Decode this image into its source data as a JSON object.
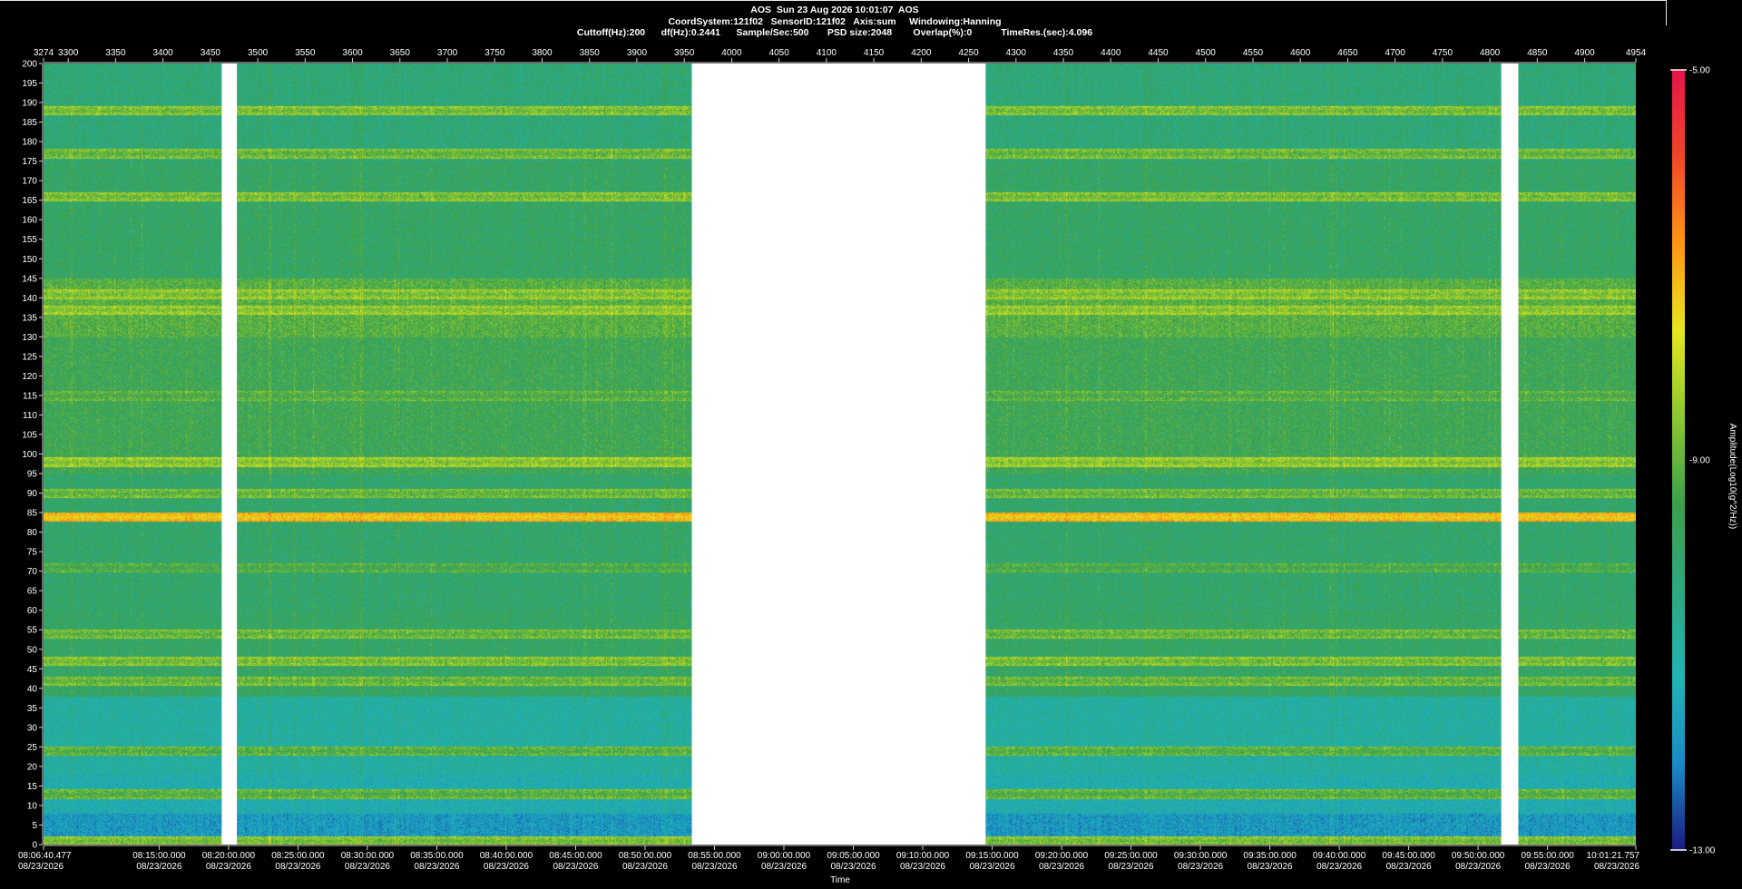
{
  "header": {
    "line1": "AOS  Sun 23 Aug 2026 10:01:07  AOS",
    "line2": "CoordSystem:121f02   SensorID:121f02   Axis:sum     Windowing:Hanning",
    "line3": "Cuttoff(Hz):200      df(Hz):0.2441      Sample/Sec:500       PSD size:2048        Overlap(%):0           TimeRes.(sec):4.096"
  },
  "chart_data": {
    "type": "heatmap",
    "title": "AOS  Sun 23 Aug 2026 10:01:07  AOS",
    "xlabel": "Time",
    "top_axis": {
      "range": [
        3274,
        4954
      ],
      "ticks": [
        "3274",
        "3300",
        "3350",
        "3400",
        "3450",
        "3500",
        "3550",
        "3600",
        "3650",
        "3700",
        "3750",
        "3800",
        "3850",
        "3900",
        "3950",
        "4000",
        "4050",
        "4100",
        "4150",
        "4200",
        "4250",
        "4300",
        "4350",
        "4400",
        "4450",
        "4500",
        "4550",
        "4600",
        "4650",
        "4700",
        "4750",
        "4800",
        "4850",
        "4900",
        "4954"
      ]
    },
    "y_axis": {
      "range": [
        0,
        200
      ],
      "ticks": [
        "0",
        "5",
        "10",
        "15",
        "20",
        "25",
        "30",
        "35",
        "40",
        "45",
        "50",
        "55",
        "60",
        "65",
        "70",
        "75",
        "80",
        "85",
        "90",
        "95",
        "100",
        "105",
        "110",
        "115",
        "120",
        "125",
        "130",
        "135",
        "140",
        "145",
        "150",
        "155",
        "160",
        "165",
        "170",
        "175",
        "180",
        "185",
        "190",
        "195",
        "200"
      ]
    },
    "time_ticks": [
      {
        "time": "08:06:40.477",
        "date": "08/23/2026"
      },
      {
        "time": "08:15:00.000",
        "date": "08/23/2026"
      },
      {
        "time": "08:20:00.000",
        "date": "08/23/2026"
      },
      {
        "time": "08:25:00.000",
        "date": "08/23/2026"
      },
      {
        "time": "08:30:00.000",
        "date": "08/23/2026"
      },
      {
        "time": "08:35:00.000",
        "date": "08/23/2026"
      },
      {
        "time": "08:40:00.000",
        "date": "08/23/2026"
      },
      {
        "time": "08:45:00.000",
        "date": "08/23/2026"
      },
      {
        "time": "08:50:00.000",
        "date": "08/23/2026"
      },
      {
        "time": "08:55:00.000",
        "date": "08/23/2026"
      },
      {
        "time": "09:00:00.000",
        "date": "08/23/2026"
      },
      {
        "time": "09:05:00.000",
        "date": "08/23/2026"
      },
      {
        "time": "09:10:00.000",
        "date": "08/23/2026"
      },
      {
        "time": "09:15:00.000",
        "date": "08/23/2026"
      },
      {
        "time": "09:20:00.000",
        "date": "08/23/2026"
      },
      {
        "time": "09:25:00.000",
        "date": "08/23/2026"
      },
      {
        "time": "09:30:00.000",
        "date": "08/23/2026"
      },
      {
        "time": "09:35:00.000",
        "date": "08/23/2026"
      },
      {
        "time": "09:40:00.000",
        "date": "08/23/2026"
      },
      {
        "time": "09:45:00.000",
        "date": "08/23/2026"
      },
      {
        "time": "09:50:00.000",
        "date": "08/23/2026"
      },
      {
        "time": "09:55:00.000",
        "date": "08/23/2026"
      },
      {
        "time": "10:01:21.757",
        "date": "08/23/2026"
      }
    ],
    "data_gaps_x": [
      [
        3462,
        3478
      ],
      [
        3958,
        4268
      ],
      [
        4812,
        4830
      ]
    ],
    "frequency_bands_hz": [
      {
        "hz": 1,
        "level": -9.0
      },
      {
        "hz": 4,
        "level": -12.3
      },
      {
        "hz": 13,
        "level": -9.4
      },
      {
        "hz": 16,
        "level": -11.6
      },
      {
        "hz": 24,
        "level": -9.4
      },
      {
        "hz": 42,
        "level": -9.2
      },
      {
        "hz": 47,
        "level": -9.0
      },
      {
        "hz": 54,
        "level": -9.2
      },
      {
        "hz": 71,
        "level": -9.6
      },
      {
        "hz": 84,
        "level": -7.5
      },
      {
        "hz": 90,
        "level": -9.2
      },
      {
        "hz": 98,
        "level": -8.8
      },
      {
        "hz": 115,
        "level": -9.5
      },
      {
        "hz": 137,
        "level": -8.8
      },
      {
        "hz": 141,
        "level": -8.9
      },
      {
        "hz": 166,
        "level": -9.0
      },
      {
        "hz": 177,
        "level": -9.2
      },
      {
        "hz": 188,
        "level": -9.0
      }
    ],
    "colorbar": {
      "label": "Amplitude(Log10(g^2/Hz))",
      "range": [
        -13.0,
        -5.0
      ],
      "ticks": [
        "-5.00",
        "-9.00",
        "-13.00"
      ],
      "colors": [
        "#1a1a80",
        "#1a8cc8",
        "#20b4b4",
        "#2ea880",
        "#3ca04a",
        "#8cc832",
        "#e6e61e",
        "#ff9614",
        "#f04628",
        "#e6144a"
      ]
    }
  }
}
